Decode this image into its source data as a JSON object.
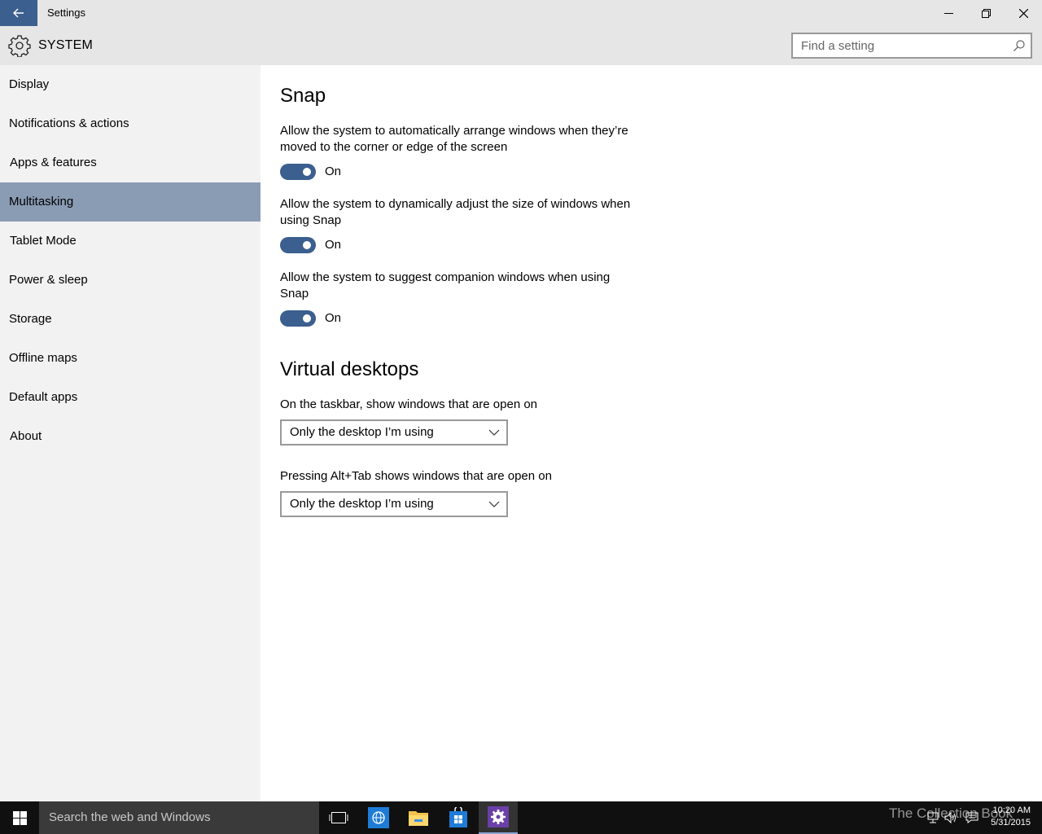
{
  "window": {
    "title": "Settings"
  },
  "header": {
    "title": "SYSTEM",
    "search_placeholder": "Find a setting"
  },
  "sidebar": {
    "items": [
      {
        "label": "Display"
      },
      {
        "label": "Notifications & actions"
      },
      {
        "label": "Apps & features"
      },
      {
        "label": "Multitasking",
        "active": true
      },
      {
        "label": "Tablet Mode"
      },
      {
        "label": "Power & sleep"
      },
      {
        "label": "Storage"
      },
      {
        "label": "Offline maps"
      },
      {
        "label": "Default apps"
      },
      {
        "label": "About"
      }
    ]
  },
  "main": {
    "snap": {
      "title": "Snap",
      "settings": [
        {
          "description": "Allow the system to automatically arrange windows when they’re moved to the corner or edge of the screen",
          "state": "On"
        },
        {
          "description": "Allow the system to dynamically adjust the size of windows when using Snap",
          "state": "On"
        },
        {
          "description": "Allow the system to suggest companion windows when using Snap",
          "state": "On"
        }
      ]
    },
    "virtual_desktops": {
      "title": "Virtual desktops",
      "taskbar_label": "On the taskbar, show windows that are open on",
      "taskbar_value": "Only the desktop I’m using",
      "alttab_label": "Pressing Alt+Tab shows windows that are open on",
      "alttab_value": "Only the desktop I’m using"
    }
  },
  "taskbar": {
    "search_placeholder": "Search the web and Windows",
    "watermark": "The Collection Book",
    "time": "10:20 AM",
    "date": "5/31/2015"
  },
  "colors": {
    "accent": "#3b5f8e",
    "active_nav": "#8a9bb4",
    "sidebar_bg": "#f2f2f2",
    "titlebar_bg": "#e6e6e6",
    "taskbar_bg": "#101010"
  },
  "icons": [
    "back-arrow-icon",
    "minimize-icon",
    "maximize-icon",
    "close-icon",
    "gear-icon",
    "search-icon",
    "chevron-down-icon",
    "windows-logo-icon",
    "task-view-icon",
    "edge-icon",
    "file-explorer-icon",
    "store-icon",
    "settings-icon",
    "network-icon",
    "volume-icon",
    "action-center-icon"
  ]
}
